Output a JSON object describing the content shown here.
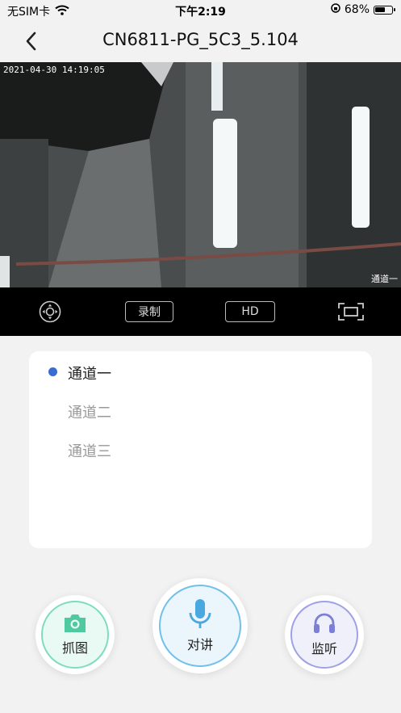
{
  "status_bar": {
    "carrier": "无SIM卡",
    "time": "下午2:19",
    "battery_percent": "68%",
    "battery_level": 0.68
  },
  "nav": {
    "title": "CN6811-PG_5C3_5.104"
  },
  "video": {
    "timestamp": "2021-04-30 14:19:05",
    "channel_overlay": "通道一"
  },
  "controls": {
    "record_label": "录制",
    "hd_label": "HD"
  },
  "channels": {
    "items": [
      "通道一",
      "通道二",
      "通道三"
    ],
    "selected": "通道一"
  },
  "actions": {
    "capture_label": "抓图",
    "talk_label": "对讲",
    "monitor_label": "监听"
  },
  "colors": {
    "accent_blue": "#3a6bd3",
    "capture_green": "#4fc9a0",
    "talk_blue": "#4aa8e0",
    "monitor_purple": "#7b7fd6"
  }
}
